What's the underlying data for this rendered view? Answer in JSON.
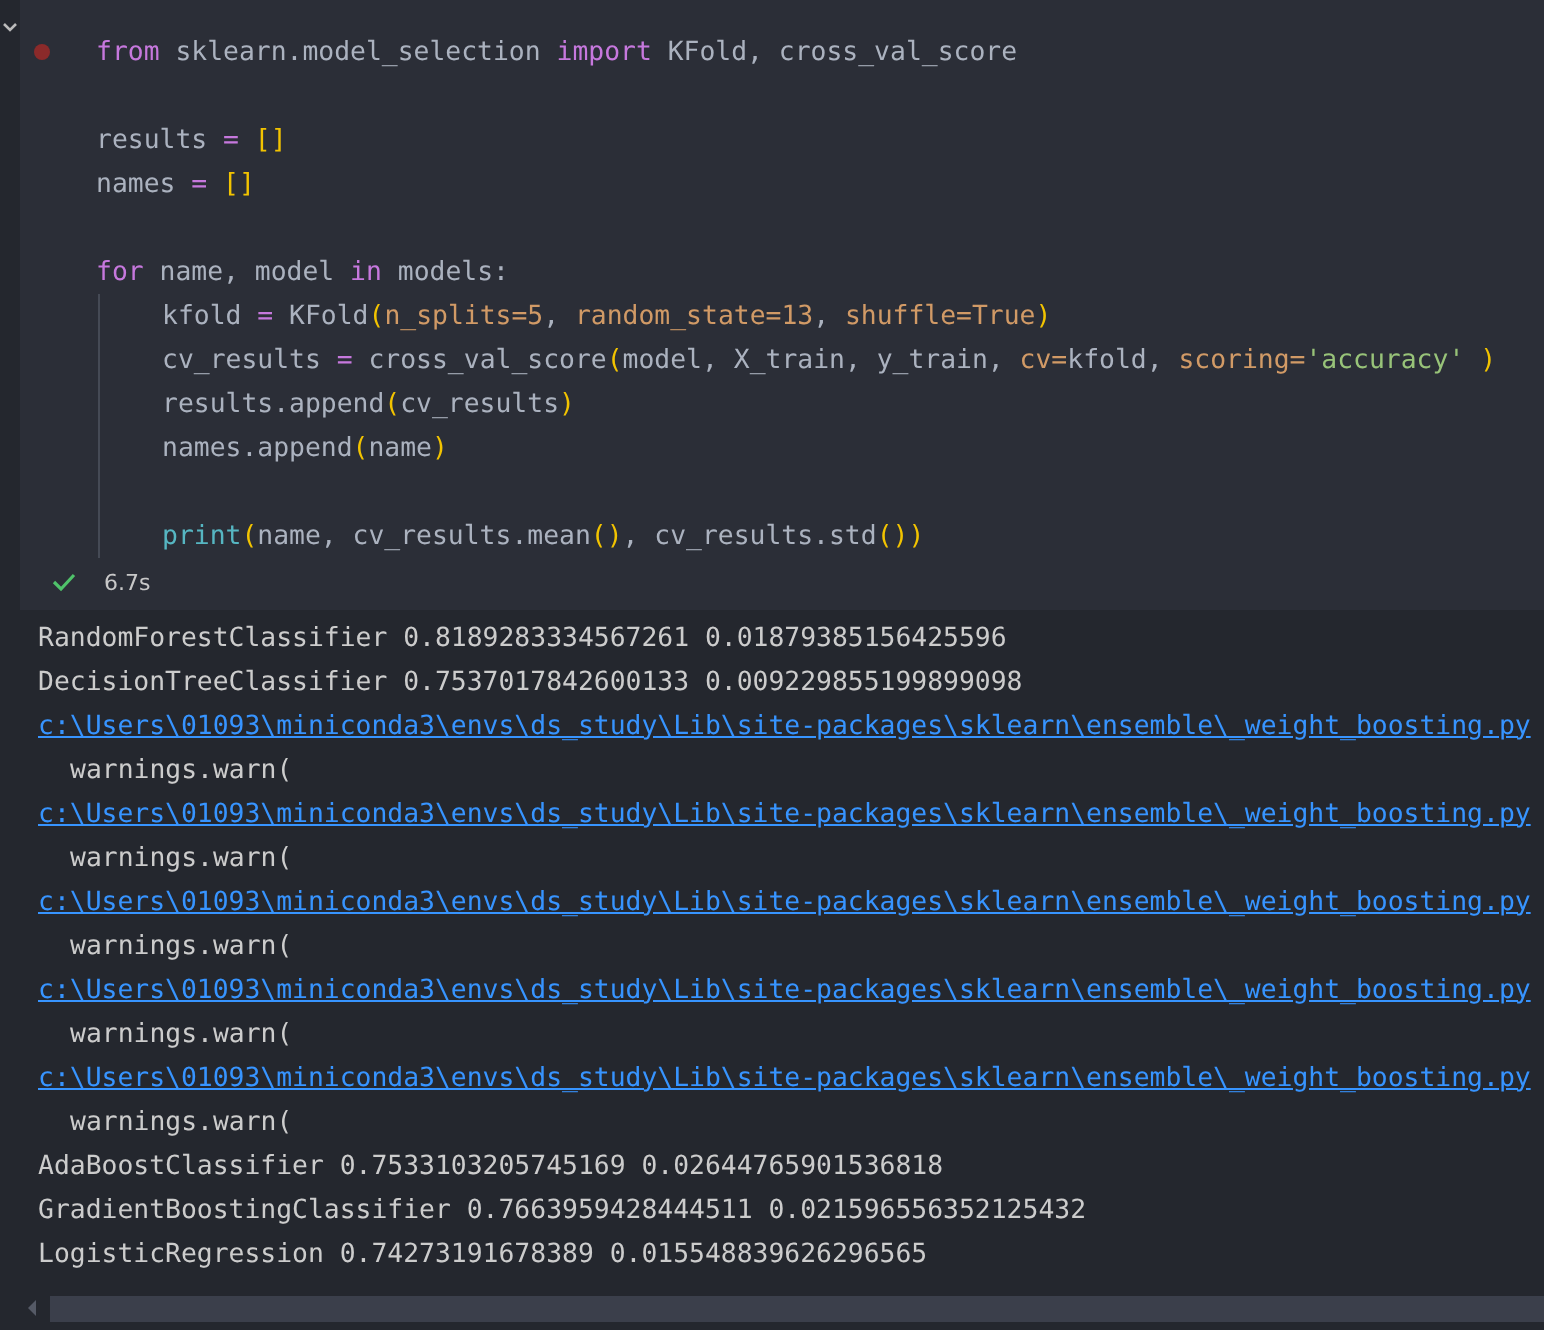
{
  "cell": {
    "code": [
      {
        "kind": "code",
        "breakpoint": true,
        "tokens": [
          {
            "text": "from",
            "kind": "kw"
          },
          {
            "text": " sklearn.model_selection ",
            "kind": "plain"
          },
          {
            "text": "import",
            "kind": "kw"
          },
          {
            "text": " KFold, cross_val_score",
            "kind": "plain"
          }
        ]
      },
      {
        "kind": "blank"
      },
      {
        "kind": "code",
        "tokens": [
          {
            "text": "results ",
            "kind": "plain"
          },
          {
            "text": "= ",
            "kind": "op"
          },
          {
            "text": "[]",
            "kind": "bracket"
          }
        ]
      },
      {
        "kind": "code",
        "tokens": [
          {
            "text": "names ",
            "kind": "plain"
          },
          {
            "text": "= ",
            "kind": "op"
          },
          {
            "text": "[]",
            "kind": "bracket"
          }
        ]
      },
      {
        "kind": "blank"
      },
      {
        "kind": "code",
        "tokens": [
          {
            "text": "for",
            "kind": "kw"
          },
          {
            "text": " name, model ",
            "kind": "plain"
          },
          {
            "text": "in",
            "kind": "kw"
          },
          {
            "text": " models:",
            "kind": "plain"
          }
        ],
        "children": [
          {
            "kind": "code",
            "tokens": [
              {
                "text": "kfold ",
                "kind": "plain"
              },
              {
                "text": "=",
                "kind": "op"
              },
              {
                "text": " KFold",
                "kind": "plain"
              },
              {
                "text": "(",
                "kind": "bracket"
              },
              {
                "text": "n_splits=5",
                "kind": "param"
              },
              {
                "text": ", ",
                "kind": "plain"
              },
              {
                "text": "random_state=13",
                "kind": "param"
              },
              {
                "text": ", ",
                "kind": "plain"
              },
              {
                "text": "shuffle=True",
                "kind": "param"
              },
              {
                "text": ")",
                "kind": "bracket"
              }
            ]
          },
          {
            "kind": "code",
            "tokens": [
              {
                "text": "cv_results ",
                "kind": "plain"
              },
              {
                "text": "=",
                "kind": "op"
              },
              {
                "text": " cross_val_score",
                "kind": "plain"
              },
              {
                "text": "(",
                "kind": "bracket"
              },
              {
                "text": "model, X_train, y_train, ",
                "kind": "plain"
              },
              {
                "text": "cv=",
                "kind": "param"
              },
              {
                "text": "kfold, ",
                "kind": "plain"
              },
              {
                "text": "scoring=",
                "kind": "param"
              },
              {
                "text": "'accuracy' ",
                "kind": "str"
              },
              {
                "text": ")",
                "kind": "bracket"
              }
            ]
          },
          {
            "kind": "code",
            "tokens": [
              {
                "text": "results.append",
                "kind": "plain"
              },
              {
                "text": "(",
                "kind": "bracket"
              },
              {
                "text": "cv_results",
                "kind": "plain"
              },
              {
                "text": ")",
                "kind": "bracket"
              }
            ]
          },
          {
            "kind": "code",
            "tokens": [
              {
                "text": "names.append",
                "kind": "plain"
              },
              {
                "text": "(",
                "kind": "bracket"
              },
              {
                "text": "name",
                "kind": "plain"
              },
              {
                "text": ")",
                "kind": "bracket"
              }
            ]
          },
          {
            "kind": "blank"
          },
          {
            "kind": "code",
            "tokens": [
              {
                "text": "print",
                "kind": "fn"
              },
              {
                "text": "(",
                "kind": "bracket"
              },
              {
                "text": "name, cv_results.mean",
                "kind": "plain"
              },
              {
                "text": "()",
                "kind": "bracket"
              },
              {
                "text": ", cv_results.std",
                "kind": "plain"
              },
              {
                "text": "()",
                "kind": "bracket"
              },
              {
                "text": ")",
                "kind": "bracket"
              }
            ]
          }
        ]
      }
    ],
    "status": {
      "succeeded": true,
      "time": "6.7s"
    }
  },
  "output": [
    {
      "kind": "plain",
      "text": "RandomForestClassifier 0.8189283334567261 0.01879385156425596"
    },
    {
      "kind": "plain",
      "text": "DecisionTreeClassifier 0.7537017842600133 0.009229855199899098"
    },
    {
      "kind": "link",
      "text": "c:\\Users\\01093\\miniconda3\\envs\\ds_study\\Lib\\site-packages\\sklearn\\ensemble\\_weight_boosting.py"
    },
    {
      "kind": "indented",
      "text": "warnings.warn("
    },
    {
      "kind": "link",
      "text": "c:\\Users\\01093\\miniconda3\\envs\\ds_study\\Lib\\site-packages\\sklearn\\ensemble\\_weight_boosting.py"
    },
    {
      "kind": "indented",
      "text": "warnings.warn("
    },
    {
      "kind": "link",
      "text": "c:\\Users\\01093\\miniconda3\\envs\\ds_study\\Lib\\site-packages\\sklearn\\ensemble\\_weight_boosting.py"
    },
    {
      "kind": "indented",
      "text": "warnings.warn("
    },
    {
      "kind": "link",
      "text": "c:\\Users\\01093\\miniconda3\\envs\\ds_study\\Lib\\site-packages\\sklearn\\ensemble\\_weight_boosting.py"
    },
    {
      "kind": "indented",
      "text": "warnings.warn("
    },
    {
      "kind": "link",
      "text": "c:\\Users\\01093\\miniconda3\\envs\\ds_study\\Lib\\site-packages\\sklearn\\ensemble\\_weight_boosting.py"
    },
    {
      "kind": "indented",
      "text": "warnings.warn("
    },
    {
      "kind": "plain",
      "text": "AdaBoostClassifier 0.7533103205745169 0.02644765901536818"
    },
    {
      "kind": "plain",
      "text": "GradientBoostingClassifier 0.7663959428444511 0.021596556352125432"
    },
    {
      "kind": "plain",
      "text": "LogisticRegression 0.74273191678389 0.015548839626296565"
    }
  ]
}
